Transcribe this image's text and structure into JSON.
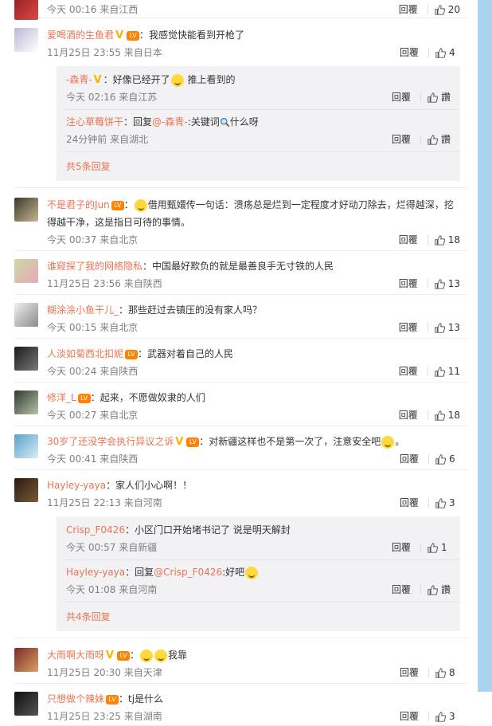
{
  "labels": {
    "reply": "回覆"
  },
  "comments": [
    {
      "name": "",
      "text": "",
      "meta": "今天 00:16 来自江西",
      "likes": "20"
    },
    {
      "name": "爱喝酒的生鱼君",
      "text": "：我感觉快能看到开枪了",
      "meta": "11月25日 23:55 来自日本",
      "likes": "4",
      "replies": [
        {
          "name": "-森青-",
          "text": "：好像已经开了",
          "text2": "推上看到的",
          "meta": "今天 02:16 来自江苏",
          "likes": "讚"
        },
        {
          "name": "注心草莓饼干",
          "text": "：回复",
          "mention": "@-森青-",
          "text2": ":关键词",
          "text3": "什么呀",
          "meta": "24分钟前 来自湖北",
          "likes": "讚"
        }
      ],
      "more": "共5条回复"
    },
    {
      "name": "不是君子的Jun",
      "text": "：",
      "text2": "借用甄嬛传一句话：溃疡总是烂到一定程度才好动刀除去，烂得越深，挖",
      "text3": "得越干净，这是指日可待的事情。",
      "meta": "今天 00:37 来自北京",
      "likes": "18"
    },
    {
      "name": "谁窥探了我的网络隐私",
      "text": "：中国最好欺负的就是最善良手无寸铁的人民",
      "meta": "11月25日 23:56 来自陕西",
      "likes": "13"
    },
    {
      "name": "糊涂涂小鱼干儿_",
      "text": "：那些赶过去镇压的没有家人吗？",
      "meta": "今天 00:15 来自北京",
      "likes": "13"
    },
    {
      "name": "人淡如菊西北扣妮",
      "text": "：武器对着自己的人民",
      "meta": "今天 00:24 来自陕西",
      "likes": "11"
    },
    {
      "name": "修洋_L",
      "text": "：起来，不愿做奴隶的人们",
      "meta": "今天 00:27 来自北京",
      "likes": "18"
    },
    {
      "name": "30岁了还没学会执行异议之诉",
      "text": "：对新疆这样也不是第一次了，注意安全吧",
      "text2": "。",
      "meta": "今天 00:41 来自陕西",
      "likes": "6"
    },
    {
      "name": "Hayley-yaya",
      "text": "：家人们小心啊！！",
      "meta": "11月25日 22:13 来自河南",
      "likes": "3",
      "replies": [
        {
          "name": "Crisp_F0426",
          "text": "：小区门口开始堵书记了 说是明天解封",
          "meta": "今天 00:57 来自新疆",
          "likes": "1"
        },
        {
          "name": "Hayley-yaya",
          "text": "：回复",
          "mention": "@Crisp_F0426",
          "text2": ":好吧",
          "meta": "今天 01:08 来自河南",
          "likes": "讚"
        }
      ],
      "more": "共4条回复"
    },
    {
      "name": "大雨啊大雨呀",
      "text": "：",
      "text2": "我靠",
      "meta": "11月25日 20:30 来自天津",
      "likes": "8"
    },
    {
      "name": "只想做个辣妹",
      "text": "：tj是什么",
      "meta": "11月25日 23:25 来自湖南",
      "likes": "3"
    }
  ],
  "icons": {
    "like": "thumb-up-icon",
    "search": "magnifier-icon",
    "emoji": "smiley-emoji-icon"
  },
  "colors": {
    "name": "#eb7350",
    "meta": "#808080",
    "sub_bg": "#f2f2f5",
    "scrollbar": "#a9d3ee"
  }
}
